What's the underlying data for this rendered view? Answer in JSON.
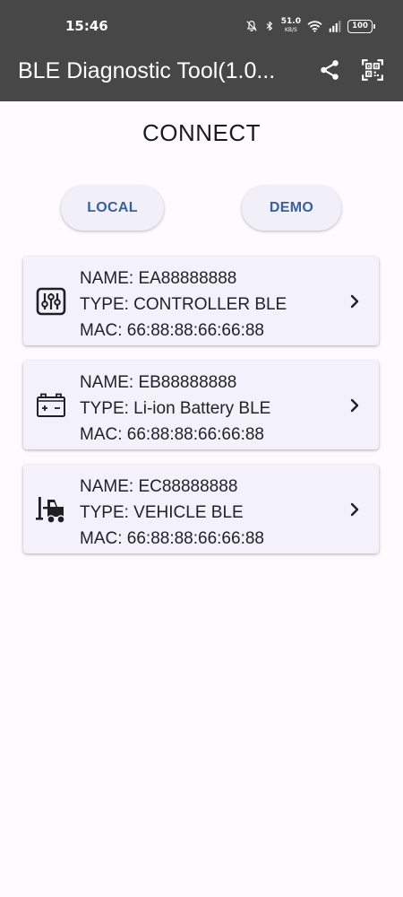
{
  "status_bar": {
    "time": "15:46",
    "net_speed": "51.0",
    "net_unit": "KB/S",
    "battery": "100"
  },
  "app_bar": {
    "title": "BLE Diagnostic Tool(1.0...",
    "actions": [
      "share-icon",
      "qr-code-icon"
    ]
  },
  "page": {
    "heading": "CONNECT",
    "buttons": {
      "local": "LOCAL",
      "demo": "DEMO"
    }
  },
  "devices": [
    {
      "icon": "controller-sliders-icon",
      "name": "NAME: EA88888888",
      "type": "TYPE: CONTROLLER  BLE",
      "mac": "MAC: 66:88:88:66:66:88"
    },
    {
      "icon": "battery-icon",
      "name": "NAME: EB88888888",
      "type": "TYPE: Li-ion Battery BLE",
      "mac": "MAC: 66:88:88:66:66:88"
    },
    {
      "icon": "forklift-icon",
      "name": "NAME: EC88888888",
      "type": "TYPE: VEHICLE BLE",
      "mac": "MAC: 66:88:88:66:66:88"
    }
  ],
  "colors": {
    "app_bar_bg": "#474747",
    "page_bg": "#fdfbff",
    "button_text": "#3a5f9b",
    "card_bg": "#f3f1f9"
  }
}
